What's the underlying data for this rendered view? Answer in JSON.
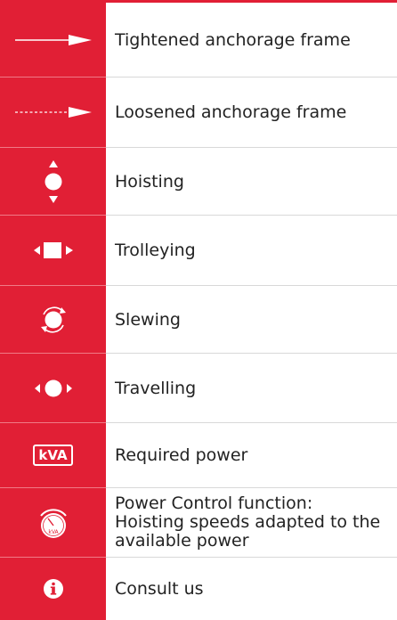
{
  "colors": {
    "accent_red": "#e11f35",
    "icon_white": "#ffffff",
    "text": "#222222"
  },
  "rows": [
    {
      "label": "Tightened anchorage frame",
      "icon": "solid-arrow-icon"
    },
    {
      "label": "Loosened anchorage frame",
      "icon": "dashed-arrow-icon"
    },
    {
      "label": "Hoisting",
      "icon": "hoisting-icon"
    },
    {
      "label": "Trolleying",
      "icon": "trolleying-icon"
    },
    {
      "label": "Slewing",
      "icon": "slewing-icon"
    },
    {
      "label": "Travelling",
      "icon": "travelling-icon"
    },
    {
      "label": "Required power",
      "icon": "kva-icon",
      "icon_text": "kVA"
    },
    {
      "label": "Power Control function:\nHoisting speeds adapted to the\navailable power",
      "lines": [
        "Power Control function:",
        "Hoisting speeds adapted to the",
        "available power"
      ],
      "icon": "power-control-icon",
      "icon_text": "kVA"
    },
    {
      "label": "Consult us",
      "icon": "info-icon"
    }
  ]
}
